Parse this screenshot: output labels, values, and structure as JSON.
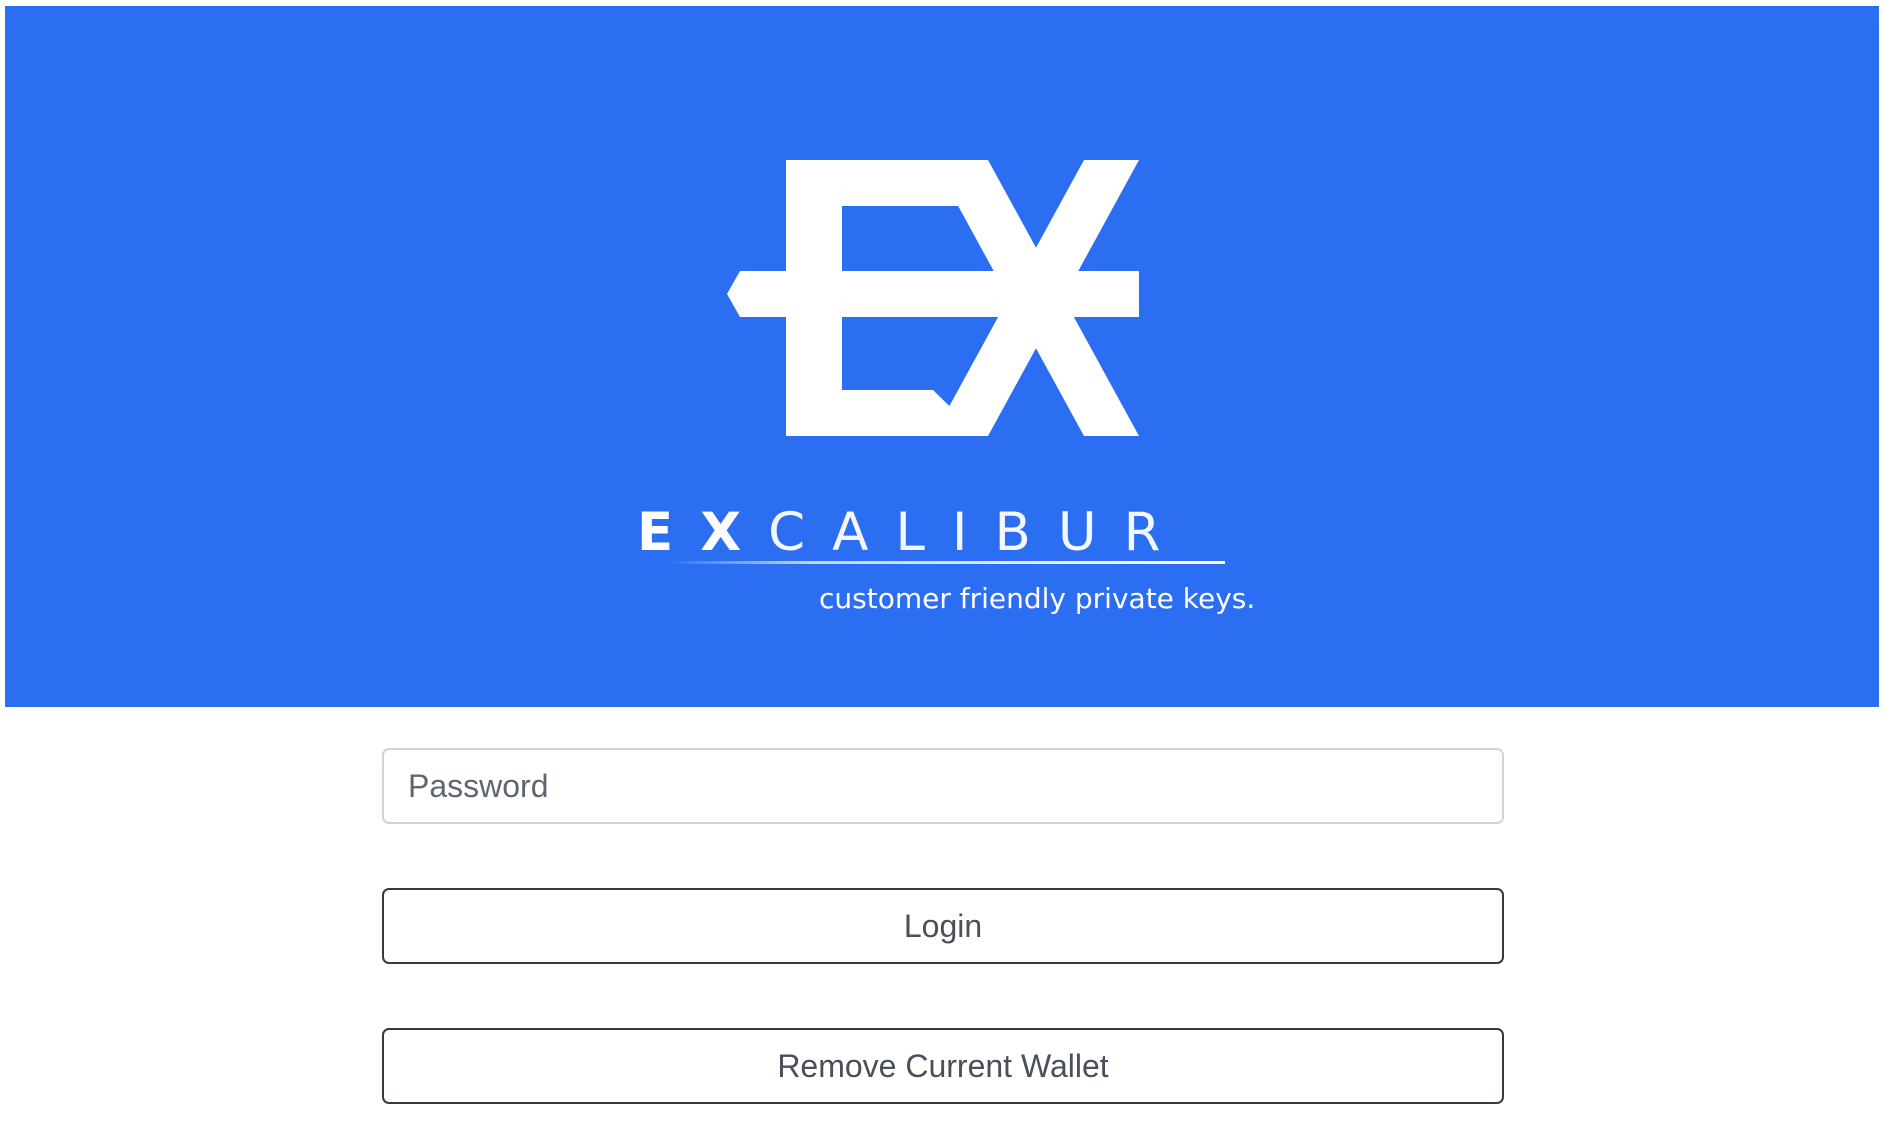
{
  "header": {
    "brand_name_bold": "EX",
    "brand_name_light": "CALIBUR",
    "tagline": "customer friendly private keys.",
    "background_color": "#2b6ef2",
    "logo_icon": "excalibur-ex-sword-logo"
  },
  "login_form": {
    "password_placeholder": "Password",
    "password_value": "",
    "login_label": "Login",
    "remove_wallet_label": "Remove Current Wallet"
  }
}
